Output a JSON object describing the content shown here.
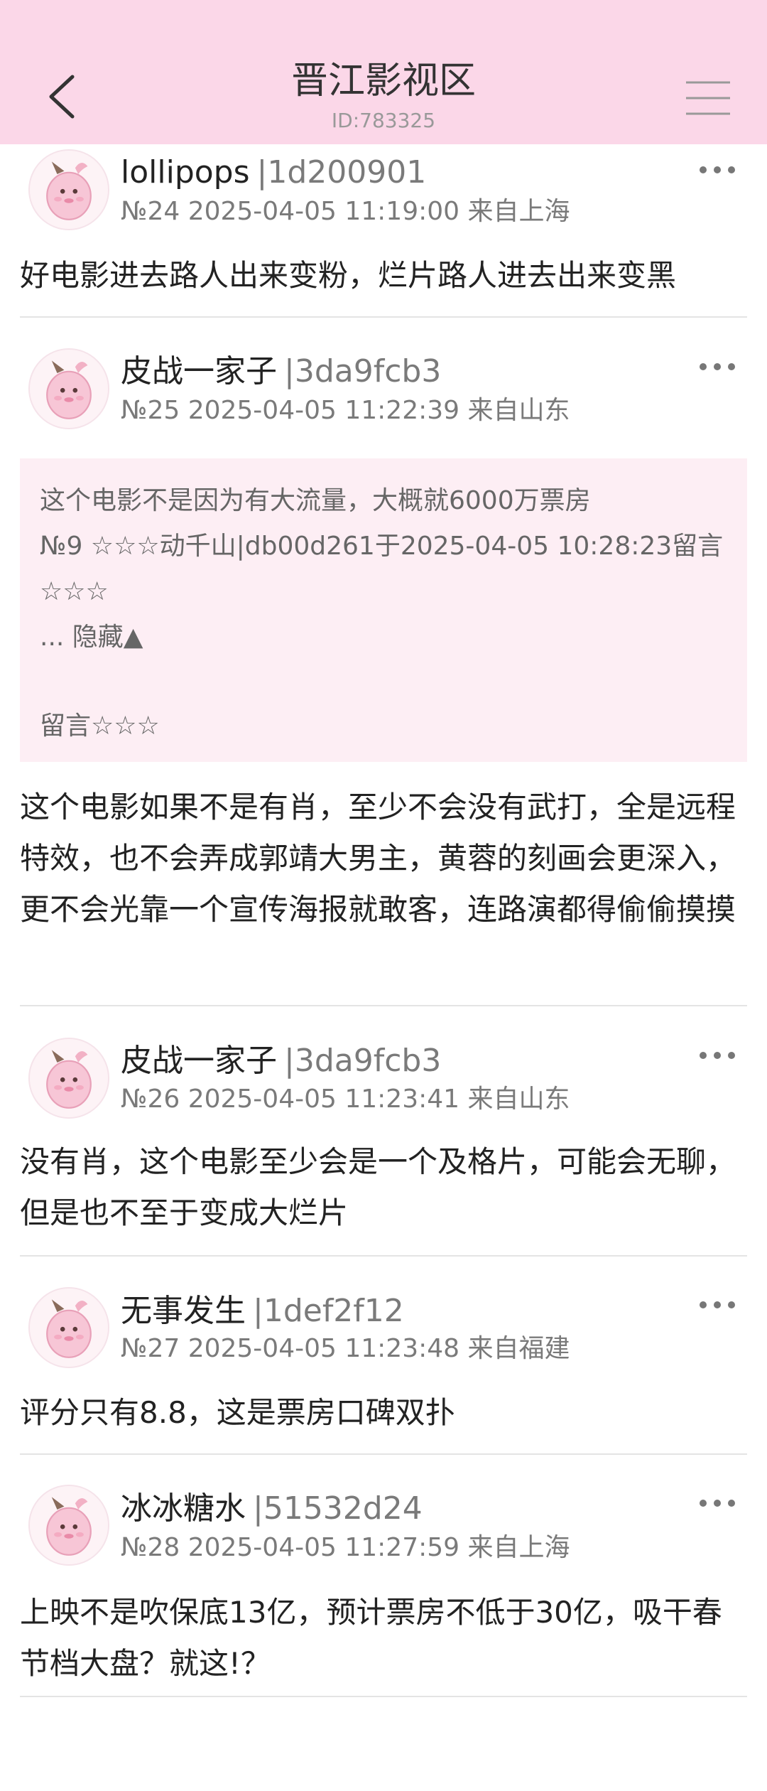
{
  "header": {
    "title": "晋江影视区",
    "id_text": "ID:783325",
    "back_icon": "chevron-left-icon",
    "menu_icon": "hamburger-menu-icon",
    "background": "#fbd7e8"
  },
  "posts": [
    {
      "name": "lollipops",
      "user_id": "|1d200901",
      "meta": "№24 2025-04-05 11:19:00 来自上海",
      "content": "好电影进去路人出来变粉，烂片路人进去出来变黑"
    },
    {
      "name": "皮战一家子",
      "user_id": "|3da9fcb3",
      "meta": "№25 2025-04-05 11:22:39 来自山东",
      "quote": {
        "line1": "这个电影不是因为有大流量，大概就6000万票房",
        "line2": "№9 ☆☆☆动千山|db00d261于2025-04-05 10:28:23留言",
        "line3": "☆☆☆",
        "line4": "... 隐藏▲",
        "line5": "留言☆☆☆"
      },
      "content": "这个电影如果不是有肖，至少不会没有武打，全是远程特效，也不会弄成郭靖大男主，黄蓉的刻画会更深入，更不会光靠一个宣传海报就敢客，连路演都得偷偷摸摸"
    },
    {
      "name": "皮战一家子",
      "user_id": "|3da9fcb3",
      "meta": "№26 2025-04-05 11:23:41 来自山东",
      "content": "没有肖，这个电影至少会是一个及格片，可能会无聊，但是也不至于变成大烂片"
    },
    {
      "name": "无事发生",
      "user_id": "|1def2f12",
      "meta": "№27 2025-04-05 11:23:48 来自福建",
      "content": "评分只有8.8，这是票房口碑双扑"
    },
    {
      "name": "冰冰糖水",
      "user_id": "|51532d24",
      "meta": "№28 2025-04-05 11:27:59 来自上海",
      "content": "上映不是吹保底13亿，预计票房不低于30亿，吸干春节档大盘？就这!？"
    }
  ]
}
